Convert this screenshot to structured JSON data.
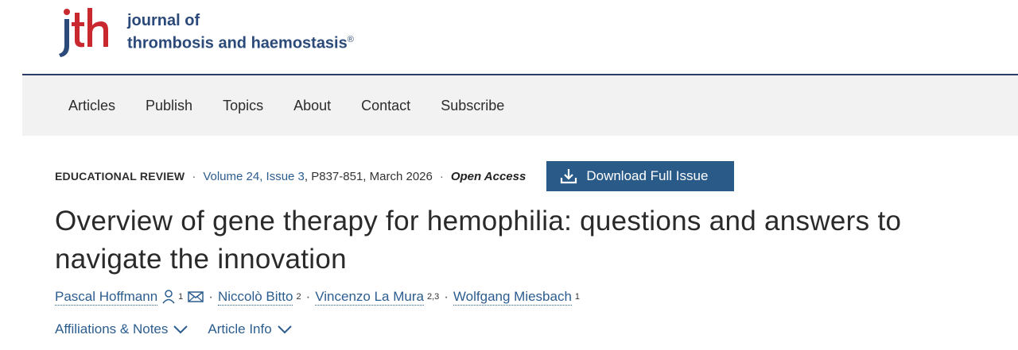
{
  "logo": {
    "mark": "jth",
    "line1": "journal of",
    "line2": "thrombosis and haemostasis",
    "registered": "®"
  },
  "nav": [
    "Articles",
    "Publish",
    "Topics",
    "About",
    "Contact",
    "Subscribe"
  ],
  "meta": {
    "type": "EDUCATIONAL REVIEW",
    "volume_issue": "Volume 24, Issue 3",
    "pages_date": ", P837-851, March 2026",
    "open_access": "Open Access",
    "download_label": "Download Full Issue"
  },
  "article": {
    "title": "Overview of gene therapy for hemophilia: questions and answers to navigate the innovation"
  },
  "authors": [
    {
      "name": "Pascal Hoffmann",
      "aff": "1"
    },
    {
      "name": "Niccolò Bitto",
      "aff": "2"
    },
    {
      "name": "Vincenzo La Mura",
      "aff": "2,3"
    },
    {
      "name": "Wolfgang Miesbach",
      "aff": "1"
    }
  ],
  "links": {
    "affiliations": "Affiliations & Notes",
    "article_info": "Article Info"
  },
  "colors": {
    "brand_navy": "#2b4a7a",
    "logo_red": "#c8282e",
    "link_blue": "#2c5d8f",
    "button_blue": "#2a5a88"
  },
  "icons": [
    "person-icon",
    "envelope-icon",
    "download-icon",
    "chevron-down-icon"
  ]
}
